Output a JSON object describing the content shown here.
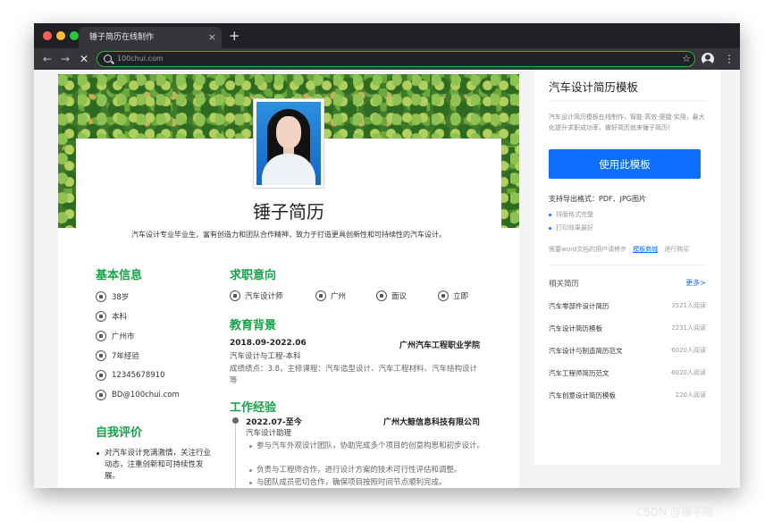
{
  "browser": {
    "tab_title": "锤子简历在线制作",
    "tab_close": "×",
    "new_tab": "+",
    "url": "100chui.com",
    "back": "←",
    "forward": "→",
    "stop": "✕",
    "star": "☆",
    "menu": "⋮"
  },
  "resume": {
    "name": "锤子简历",
    "summary": "汽车设计专业毕业生，富有创造力和团队合作精神，致力于打造更具创新性和可持续性的汽车设计。",
    "basic_title": "基本信息",
    "basic": [
      {
        "icon": "calendar-icon",
        "text": "38岁"
      },
      {
        "icon": "graduation-icon",
        "text": "本科"
      },
      {
        "icon": "location-icon",
        "text": "广州市"
      },
      {
        "icon": "briefcase-icon",
        "text": "7年经验"
      },
      {
        "icon": "phone-icon",
        "text": "12345678910"
      },
      {
        "icon": "email-icon",
        "text": "BD@100chui.com"
      }
    ],
    "self_title": "自我评价",
    "self_text": "对汽车设计充满激情，关注行业动态，注重创新和可持续性发展。",
    "intent_title": "求职意向",
    "intent": [
      {
        "icon": "tie-icon",
        "text": "汽车设计师"
      },
      {
        "icon": "city-icon",
        "text": "广州"
      },
      {
        "icon": "yen-icon",
        "text": "面议"
      },
      {
        "icon": "clock-icon",
        "text": "立即"
      }
    ],
    "edu_title": "教育背景",
    "edu": {
      "date": "2018.09-2022.06",
      "school": "广州汽车工程职业学院",
      "major": "汽车设计与工程-本科",
      "detail": "成绩绩点：3.8，主修课程：汽车造型设计、汽车工程材料、汽车结构设计等"
    },
    "work_title": "工作经验",
    "work": {
      "date": "2022.07-至今",
      "company": "广州大鲸信息科技有限公司",
      "title": "汽车设计助理",
      "duties": [
        "参与汽车外观设计团队，协助完成多个项目的创意构思和初步设计。",
        "负责与工程师合作，进行设计方案的技术可行性评估和调整。",
        "与团队成员密切合作，确保项目按照时间节点顺利完成。"
      ]
    }
  },
  "sidebar": {
    "title": "汽车设计简历模板",
    "desc": "汽车设计简历模板在线制作，智能·高效·便捷·实用，最大化提升求职成功率，做好简历就来锤子简历！",
    "use_button": "使用此模板",
    "export_text": "支持导出格式：PDF、JPG图片",
    "bullets": [
      "排版格式完整",
      "打印效果最好"
    ],
    "word_prefix": "需要word文档的用户请移步",
    "word_link": "模板商城",
    "word_suffix": "进行购买",
    "related_title": "相关简历",
    "more": "更多>",
    "related": [
      {
        "name": "汽车零部件设计简历",
        "views": "3521人阅读"
      },
      {
        "name": "汽车设计简历模板",
        "views": "2231人阅读"
      },
      {
        "name": "汽车设计与制造简历范文",
        "views": "6020人阅读"
      },
      {
        "name": "汽车工程师简历范文",
        "views": "6020人阅读"
      },
      {
        "name": "汽车创意设计简历模板",
        "views": "220人阅读"
      }
    ]
  },
  "watermark": "CSDN @锤子简",
  "colors": {
    "accent": "#16a34a",
    "button": "#0d6efd"
  }
}
